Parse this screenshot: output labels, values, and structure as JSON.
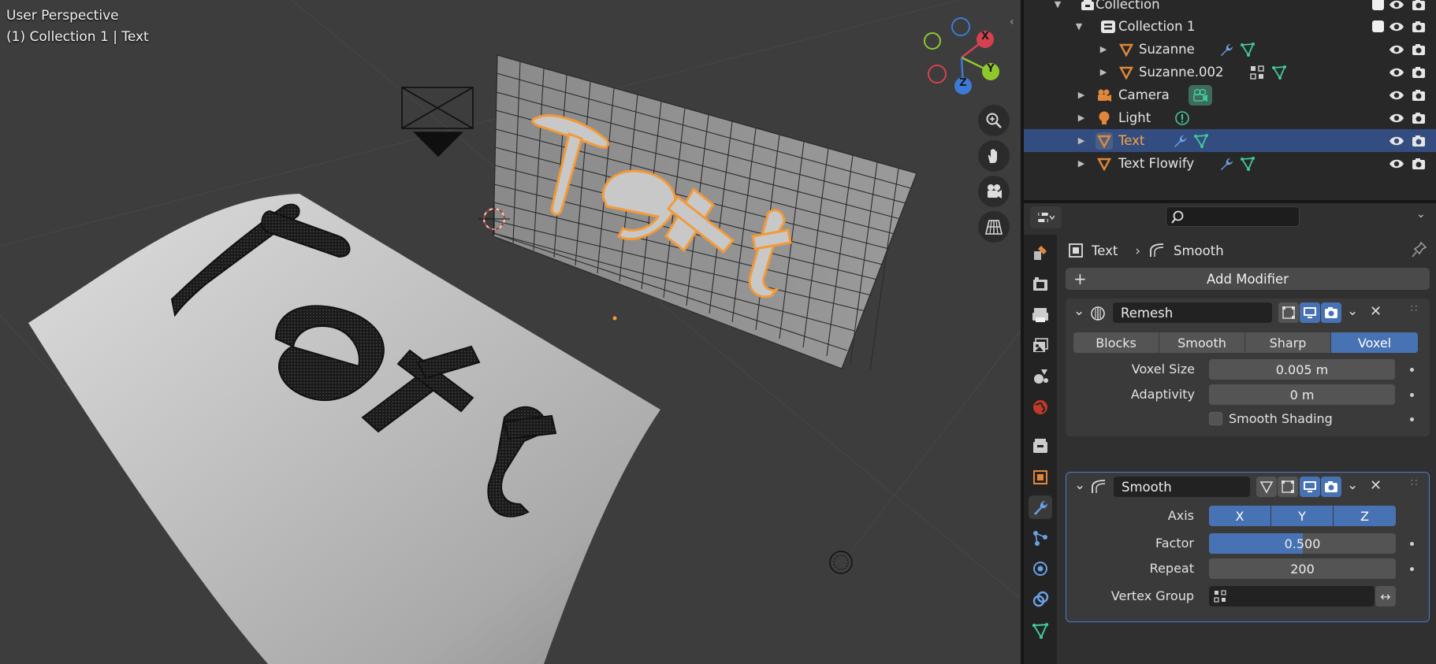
{
  "viewport": {
    "perspective_label": "User Perspective",
    "context_label": "(1) Collection 1 | Text",
    "scene_text": "Text",
    "gizmo": {
      "x_label": "X",
      "y_label": "Y",
      "z_label": "Z"
    }
  },
  "outliner": {
    "rows": [
      {
        "label": "Collection",
        "type": "collection"
      },
      {
        "label": "Collection 1",
        "type": "collection"
      },
      {
        "label": "Suzanne",
        "type": "mesh"
      },
      {
        "label": "Suzanne.002",
        "type": "mesh"
      },
      {
        "label": "Camera",
        "type": "camera"
      },
      {
        "label": "Light",
        "type": "light"
      },
      {
        "label": "Text",
        "type": "mesh",
        "selected": true
      },
      {
        "label": "Text Flowify",
        "type": "mesh"
      }
    ]
  },
  "properties": {
    "breadcrumb": {
      "object": "Text",
      "modifier": "Smooth"
    },
    "add_modifier_label": "Add Modifier",
    "remesh": {
      "name": "Remesh",
      "modes": [
        "Blocks",
        "Smooth",
        "Sharp",
        "Voxel"
      ],
      "active_mode": "Voxel",
      "voxel_size_label": "Voxel Size",
      "voxel_size_value": "0.005 m",
      "adaptivity_label": "Adaptivity",
      "adaptivity_value": "0 m",
      "smooth_shading_label": "Smooth Shading",
      "smooth_shading_checked": false
    },
    "smooth": {
      "name": "Smooth",
      "axis_label": "Axis",
      "axes": [
        "X",
        "Y",
        "Z"
      ],
      "factor_label": "Factor",
      "factor_value": "0.500",
      "factor_fraction": 0.5,
      "repeat_label": "Repeat",
      "repeat_value": "200",
      "vertex_group_label": "Vertex Group",
      "vertex_group_value": ""
    }
  },
  "colors": {
    "selection": "#334d80",
    "accent_blue": "#4772b3",
    "active_orange": "#f5a543",
    "mesh_orange": "#e0873a",
    "modifier_icon_blue": "#6aa0e6",
    "data_icon_green": "#40c89a"
  }
}
